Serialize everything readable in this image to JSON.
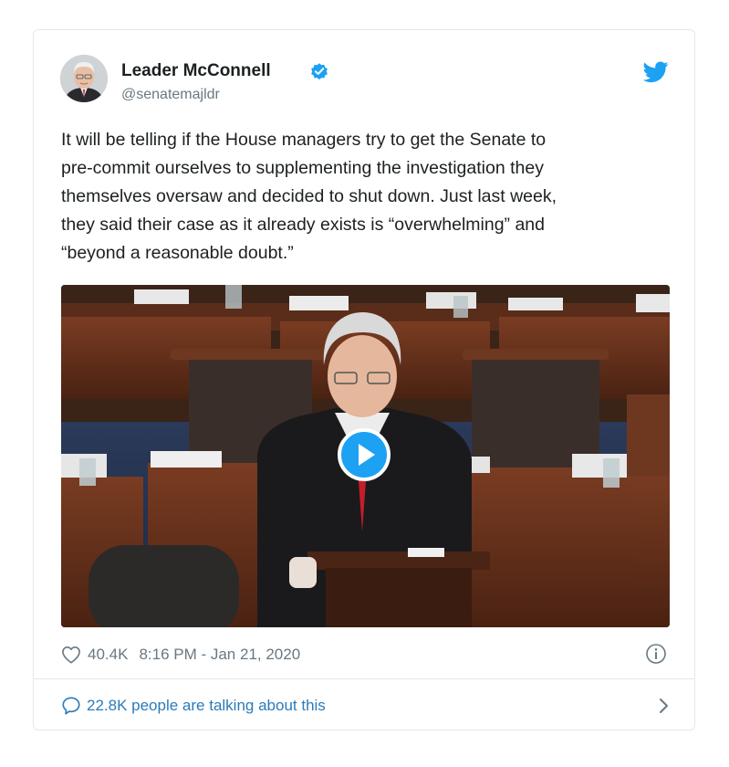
{
  "tweet": {
    "author": {
      "display_name": "Leader McConnell",
      "handle": "@senatemajldr",
      "verified": true
    },
    "text": "It will be telling if the House managers try to get the Senate to\npre-commit ourselves to supplementing the investigation they\nthemselves oversaw and decided to shut down. Just last week,\nthey said their case as it already exists is “overwhelming” and\n“beyond a reasonable doubt.”",
    "media": {
      "type": "video",
      "icon": "play-icon"
    },
    "likes": "40.4K",
    "timestamp": "8:16 PM - Jan 21, 2020",
    "conversation": "22.8K people are talking about this"
  },
  "colors": {
    "twitter_blue": "#1da1f2",
    "link_blue": "#2b7bb9",
    "meta_gray": "#697882",
    "border": "#e1e8ed"
  }
}
